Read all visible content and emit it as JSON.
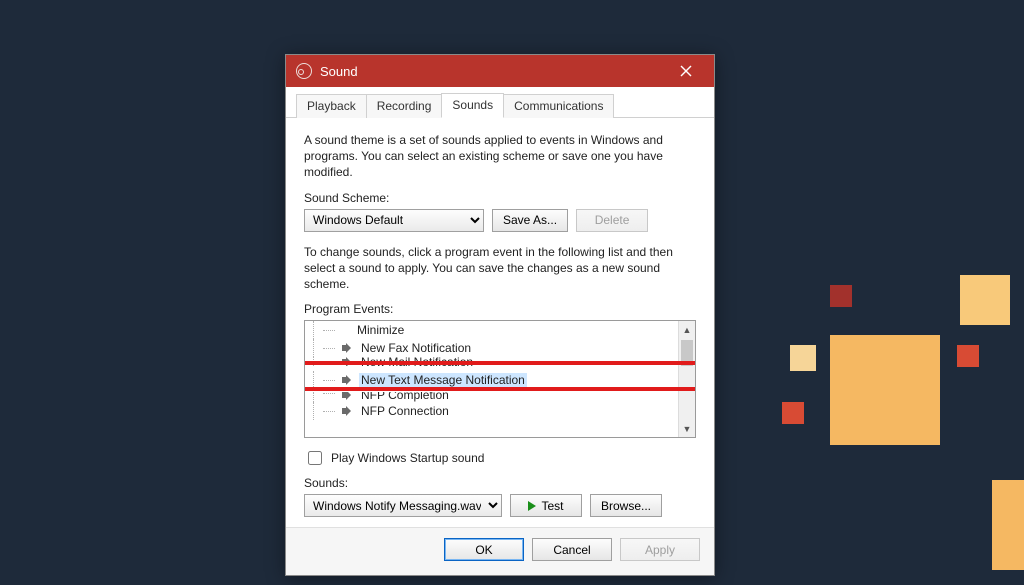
{
  "window": {
    "title": "Sound",
    "close_label": "Close"
  },
  "tabs": [
    "Playback",
    "Recording",
    "Sounds",
    "Communications"
  ],
  "active_tab_index": 2,
  "panel": {
    "description": "A sound theme is a set of sounds applied to events in Windows and programs.  You can select an existing scheme or save one you have modified.",
    "scheme_label": "Sound Scheme:",
    "scheme_value": "Windows Default",
    "save_as": "Save As...",
    "delete": "Delete",
    "events_description": "To change sounds, click a program event in the following list and then select a sound to apply.  You can save the changes as a new sound scheme.",
    "events_label": "Program Events:",
    "events": [
      {
        "label": "Minimize",
        "has_sound": false
      },
      {
        "label": "New Fax Notification",
        "has_sound": true
      },
      {
        "label": "New Mail Notification",
        "has_sound": true
      },
      {
        "label": "New Text Message Notification",
        "has_sound": true,
        "selected": true
      },
      {
        "label": "NFP Completion",
        "has_sound": true
      },
      {
        "label": "NFP Connection",
        "has_sound": true
      }
    ],
    "startup_label": "Play Windows Startup sound",
    "startup_checked": false,
    "sounds_label": "Sounds:",
    "sounds_value": "Windows Notify Messaging.wav",
    "test": "Test",
    "browse": "Browse..."
  },
  "buttons": {
    "ok": "OK",
    "cancel": "Cancel",
    "apply": "Apply"
  }
}
